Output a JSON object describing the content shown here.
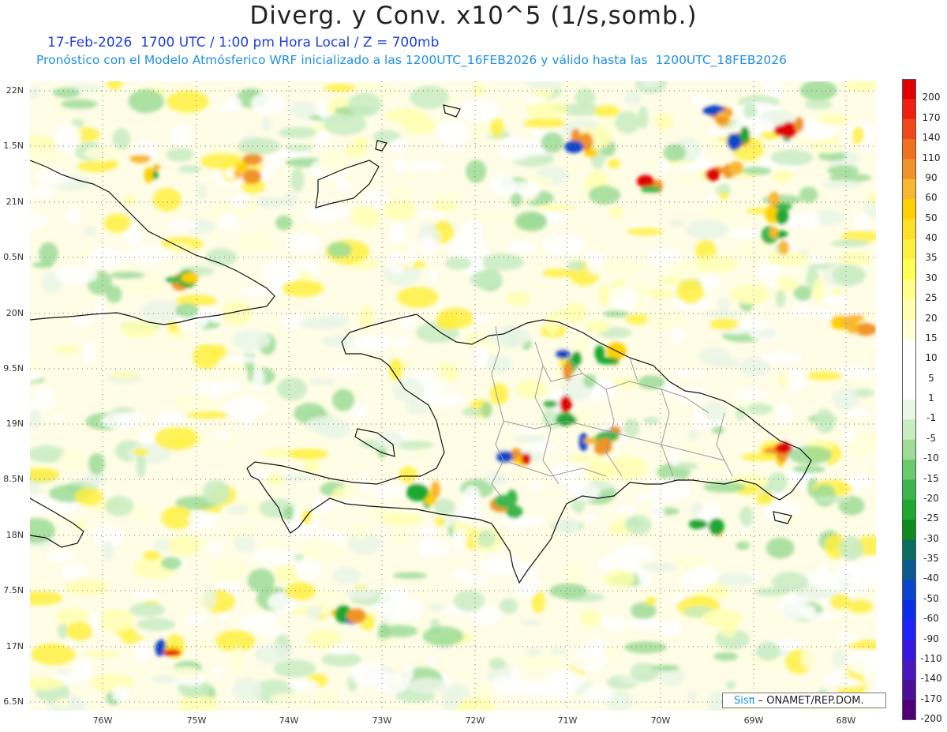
{
  "header": {
    "title": "Diverg. y Conv. x10^5 (1/s,somb.)",
    "subtitle1": "17-Feb-2026  1700 UTC / 1:00 pm Hora Local / Z = 700mb",
    "subtitle2": "Pronóstico con el Modelo Atmósferico WRF inicializado a las 1200UTC_16FEB2026 y válido hasta las  1200UTC_18FEB2026"
  },
  "axes": {
    "lat_labels": [
      "22N",
      "1.5N",
      "21N",
      "0.5N",
      "20N",
      "9.5N",
      "19N",
      "8.5N",
      "18N",
      "7.5N",
      "17N",
      "6.5N"
    ],
    "lon_labels": [
      "76W",
      "75W",
      "74W",
      "73W",
      "72W",
      "71W",
      "70W",
      "69W",
      "68W"
    ]
  },
  "colorbar": {
    "labels": [
      "200",
      "170",
      "140",
      "110",
      "90",
      "60",
      "50",
      "40",
      "35",
      "30",
      "25",
      "20",
      "15",
      "10",
      "5",
      "1",
      "-1",
      "-5",
      "-10",
      "-15",
      "-20",
      "-25",
      "-30",
      "-35",
      "-40",
      "-50",
      "-60",
      "-90",
      "-110",
      "-140",
      "-170",
      "-200"
    ],
    "colors": [
      "#e00000",
      "#f02010",
      "#f04818",
      "#f07020",
      "#f09428",
      "#f8b830",
      "#ffd000",
      "#ffe028",
      "#fff040",
      "#ffff55",
      "#ffff88",
      "#ffffb0",
      "#ffffd8",
      "#ffffff",
      "#ffffff",
      "#ffffff",
      "#eaf6e6",
      "#c8ecc2",
      "#9edc98",
      "#6acb6a",
      "#3cb64c",
      "#1ea830",
      "#0e8a1e",
      "#0a6e5e",
      "#0a5a8e",
      "#0a46c8",
      "#0a2ee8",
      "#2020ff",
      "#3818e0",
      "#4818c0",
      "#4a1098",
      "#500078"
    ]
  },
  "credit": {
    "sis": "Sisπ",
    "rest": "– ONAMET/REP.DOM."
  },
  "colors": {
    "land_outline": "#111111",
    "province_lines": "#999999",
    "grid": "#888888"
  }
}
